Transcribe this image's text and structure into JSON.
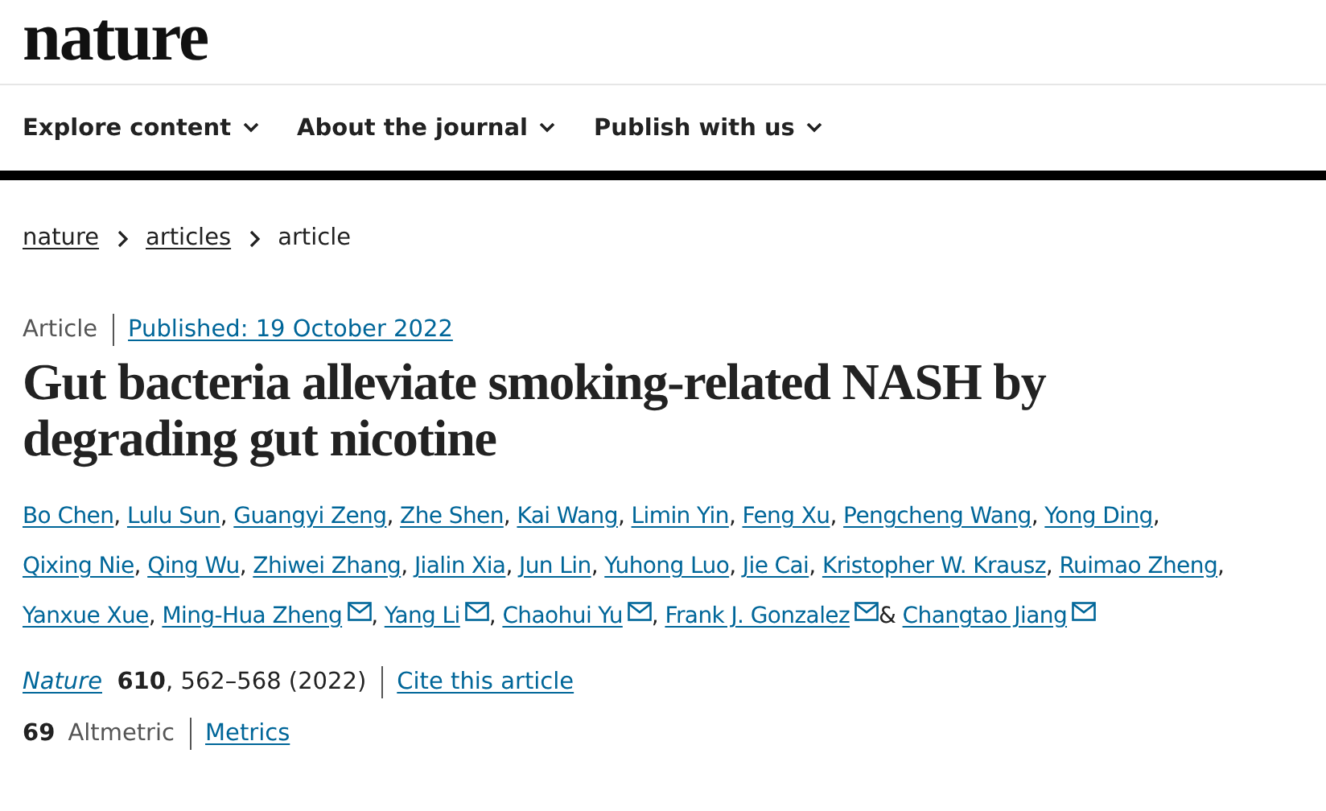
{
  "site": {
    "logo": "nature"
  },
  "nav": [
    {
      "label": "Explore content",
      "expandable": true
    },
    {
      "label": "About the journal",
      "expandable": true
    },
    {
      "label": "Publish with us",
      "expandable": true
    }
  ],
  "breadcrumb": [
    "nature",
    "articles",
    "article"
  ],
  "article": {
    "type": "Article",
    "published": "Published: 19 October 2022",
    "title": "Gut bacteria alleviate smoking-related NASH by degrading gut nicotine",
    "authors": [
      {
        "name": "Bo Chen",
        "corresponding": false,
        "after": ","
      },
      {
        "name": "Lulu Sun",
        "corresponding": false,
        "after": ","
      },
      {
        "name": "Guangyi Zeng",
        "corresponding": false,
        "after": ","
      },
      {
        "name": "Zhe Shen",
        "corresponding": false,
        "after": ","
      },
      {
        "name": "Kai Wang",
        "corresponding": false,
        "after": ","
      },
      {
        "name": "Limin Yin",
        "corresponding": false,
        "after": ","
      },
      {
        "name": "Feng Xu",
        "corresponding": false,
        "after": ","
      },
      {
        "name": "Pengcheng Wang",
        "corresponding": false,
        "after": ","
      },
      {
        "name": "Yong Ding",
        "corresponding": false,
        "after": ","
      },
      {
        "name": "Qixing Nie",
        "corresponding": false,
        "after": ","
      },
      {
        "name": "Qing Wu",
        "corresponding": false,
        "after": ","
      },
      {
        "name": "Zhiwei Zhang",
        "corresponding": false,
        "after": ","
      },
      {
        "name": "Jialin Xia",
        "corresponding": false,
        "after": ","
      },
      {
        "name": "Jun Lin",
        "corresponding": false,
        "after": ","
      },
      {
        "name": "Yuhong Luo",
        "corresponding": false,
        "after": ","
      },
      {
        "name": "Jie Cai",
        "corresponding": false,
        "after": ","
      },
      {
        "name": "Kristopher W. Krausz",
        "corresponding": false,
        "after": ","
      },
      {
        "name": "Ruimao Zheng",
        "corresponding": false,
        "after": ","
      },
      {
        "name": "Yanxue Xue",
        "corresponding": false,
        "after": ","
      },
      {
        "name": "Ming-Hua Zheng",
        "corresponding": true,
        "after": ","
      },
      {
        "name": "Yang Li",
        "corresponding": true,
        "after": ","
      },
      {
        "name": "Chaohui Yu",
        "corresponding": true,
        "after": ","
      },
      {
        "name": "Frank J. Gonzalez",
        "corresponding": true,
        "after": "&"
      },
      {
        "name": "Changtao Jiang",
        "corresponding": true
      }
    ],
    "journal": "Nature",
    "citation": "**610**, 562–568 (2022)",
    "cite_link": "Cite this article",
    "altmetric_score": "69",
    "altmetric_label": "Altmetric",
    "metrics_link": "Metrics"
  }
}
